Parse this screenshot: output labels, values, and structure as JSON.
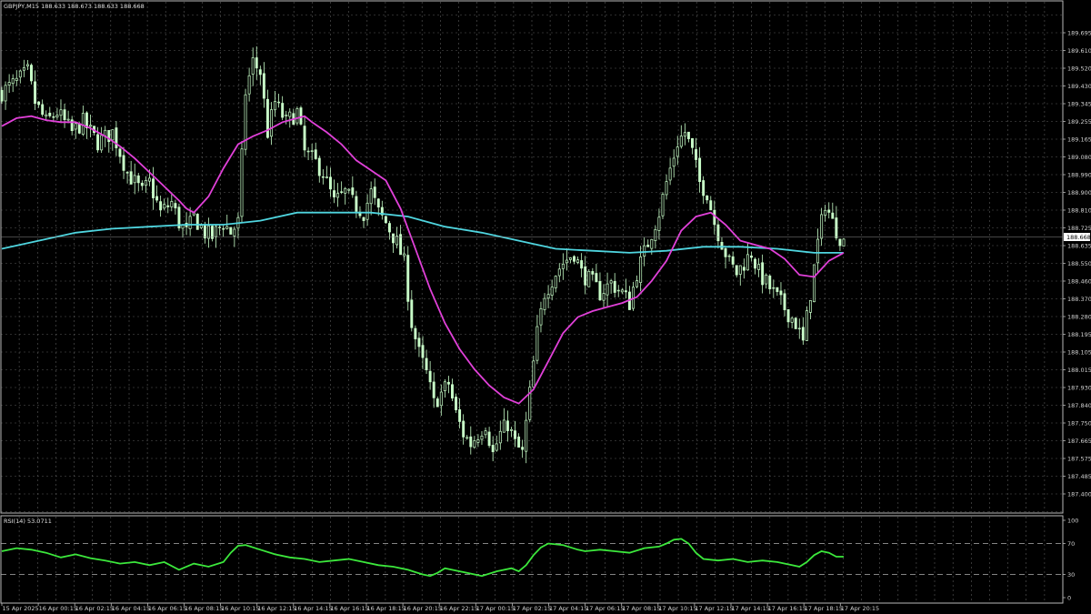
{
  "header": {
    "main_title": "GBPJPY,M15  188.633 188.673 188.633 188.668",
    "rsi_title": "RSI(14) 53.0711"
  },
  "colors": {
    "background": "#000000",
    "grid": "#5a5a5a",
    "candle": "#c9ffc9",
    "ma_fast": "#e040d8",
    "ma_slow": "#4fd5df",
    "rsi": "#3ce83c",
    "axis_text": "#d0d0d0",
    "price_tag_bg": "#ffffff"
  },
  "current_price_label": "188.668",
  "chart_data": [
    {
      "type": "candlestick",
      "title": "GBPJPY,M15",
      "symbol": "GBPJPY",
      "timeframe": "M15",
      "last_bar": {
        "open": 188.633,
        "high": 188.673,
        "low": 188.633,
        "close": 188.668
      },
      "y_ticks": [
        "189.695",
        "189.610",
        "189.520",
        "189.430",
        "189.345",
        "189.255",
        "189.165",
        "189.080",
        "188.990",
        "188.900",
        "188.810",
        "188.725",
        "188.635",
        "188.550",
        "188.460",
        "188.370",
        "188.280",
        "188.195",
        "188.105",
        "188.015",
        "187.930",
        "187.840",
        "187.750",
        "187.665",
        "187.575",
        "187.485",
        "187.400"
      ],
      "ylim": [
        187.4,
        189.695
      ],
      "x_ticks": [
        "15 Apr 2025",
        "16 Apr 00:15",
        "16 Apr 02:15",
        "16 Apr 04:15",
        "16 Apr 06:15",
        "16 Apr 08:15",
        "16 Apr 10:15",
        "16 Apr 12:15",
        "16 Apr 14:15",
        "16 Apr 16:15",
        "16 Apr 18:15",
        "16 Apr 20:15",
        "16 Apr 22:15",
        "17 Apr 00:15",
        "17 Apr 02:15",
        "17 Apr 04:15",
        "17 Apr 06:15",
        "17 Apr 08:15",
        "17 Apr 10:15",
        "17 Apr 12:15",
        "17 Apr 14:15",
        "17 Apr 16:15",
        "17 Apr 18:15",
        "17 Apr 20:15"
      ],
      "price_path": [
        [
          0,
          189.4
        ],
        [
          4,
          189.45
        ],
        [
          7,
          189.5
        ],
        [
          9,
          189.35
        ],
        [
          12,
          189.25
        ],
        [
          15,
          189.3
        ],
        [
          19,
          189.2
        ],
        [
          22,
          189.25
        ],
        [
          26,
          189.15
        ],
        [
          30,
          189.2
        ],
        [
          34,
          189.0
        ],
        [
          38,
          188.9
        ],
        [
          40,
          188.95
        ],
        [
          43,
          188.8
        ],
        [
          46,
          188.85
        ],
        [
          48,
          188.75
        ],
        [
          50,
          188.7
        ],
        [
          52,
          188.78
        ],
        [
          55,
          188.7
        ],
        [
          57,
          188.68
        ],
        [
          60,
          188.75
        ],
        [
          62,
          188.7
        ],
        [
          64,
          188.75
        ],
        [
          66,
          189.4
        ],
        [
          68,
          189.55
        ],
        [
          70,
          189.5
        ],
        [
          72,
          189.2
        ],
        [
          74,
          189.35
        ],
        [
          77,
          189.25
        ],
        [
          80,
          189.3
        ],
        [
          82,
          189.1
        ],
        [
          85,
          189.05
        ],
        [
          87,
          189.0
        ],
        [
          90,
          188.85
        ],
        [
          93,
          188.9
        ],
        [
          95,
          188.85
        ],
        [
          98,
          188.8
        ],
        [
          100,
          188.9
        ],
        [
          102,
          188.8
        ],
        [
          104,
          188.75
        ],
        [
          107,
          188.65
        ],
        [
          109,
          188.55
        ],
        [
          111,
          188.25
        ],
        [
          113,
          188.1
        ],
        [
          115,
          188.0
        ],
        [
          117,
          187.85
        ],
        [
          119,
          187.9
        ],
        [
          121,
          187.95
        ],
        [
          123,
          187.8
        ],
        [
          125,
          187.7
        ],
        [
          127,
          187.65
        ],
        [
          129,
          187.7
        ],
        [
          131,
          187.75
        ],
        [
          133,
          187.6
        ],
        [
          135,
          187.7
        ],
        [
          137,
          187.75
        ],
        [
          139,
          187.65
        ],
        [
          141,
          187.6
        ],
        [
          143,
          187.9
        ],
        [
          145,
          188.2
        ],
        [
          147,
          188.4
        ],
        [
          150,
          188.5
        ],
        [
          152,
          188.55
        ],
        [
          155,
          188.6
        ],
        [
          157,
          188.5
        ],
        [
          160,
          188.45
        ],
        [
          162,
          188.4
        ],
        [
          165,
          188.45
        ],
        [
          168,
          188.4
        ],
        [
          170,
          188.35
        ],
        [
          172,
          188.5
        ],
        [
          174,
          188.6
        ],
        [
          176,
          188.7
        ],
        [
          178,
          188.8
        ],
        [
          180,
          188.95
        ],
        [
          183,
          189.15
        ],
        [
          185,
          189.2
        ],
        [
          187,
          189.1
        ],
        [
          189,
          188.95
        ],
        [
          191,
          188.9
        ],
        [
          193,
          188.75
        ],
        [
          195,
          188.65
        ],
        [
          197,
          188.55
        ],
        [
          199,
          188.5
        ],
        [
          201,
          188.55
        ],
        [
          203,
          188.6
        ],
        [
          205,
          188.5
        ],
        [
          207,
          188.45
        ],
        [
          209,
          188.4
        ],
        [
          211,
          188.35
        ],
        [
          213,
          188.3
        ],
        [
          215,
          188.25
        ],
        [
          217,
          188.15
        ],
        [
          219,
          188.4
        ],
        [
          221,
          188.65
        ],
        [
          223,
          188.85
        ],
        [
          225,
          188.75
        ],
        [
          227,
          188.68
        ]
      ],
      "series": [
        {
          "name": "",
          "points": [
            [
              0,
              189.23
            ],
            [
              4,
              189.27
            ],
            [
              8,
              189.28
            ],
            [
              12,
              189.26
            ],
            [
              16,
              189.25
            ],
            [
              20,
              189.25
            ],
            [
              24,
              189.22
            ],
            [
              28,
              189.18
            ],
            [
              32,
              189.13
            ],
            [
              36,
              189.07
            ],
            [
              40,
              189.0
            ],
            [
              44,
              188.93
            ],
            [
              48,
              188.86
            ],
            [
              50,
              188.82
            ],
            [
              52,
              188.8
            ],
            [
              56,
              188.88
            ],
            [
              60,
              189.02
            ],
            [
              64,
              189.14
            ],
            [
              68,
              189.18
            ],
            [
              72,
              189.21
            ],
            [
              76,
              189.25
            ],
            [
              80,
              189.27
            ],
            [
              82,
              189.28
            ],
            [
              84,
              189.25
            ],
            [
              88,
              189.2
            ],
            [
              92,
              189.14
            ],
            [
              96,
              189.06
            ],
            [
              100,
              189.01
            ],
            [
              104,
              188.96
            ],
            [
              108,
              188.82
            ],
            [
              112,
              188.62
            ],
            [
              116,
              188.42
            ],
            [
              120,
              188.25
            ],
            [
              124,
              188.12
            ],
            [
              128,
              188.02
            ],
            [
              132,
              187.94
            ],
            [
              136,
              187.88
            ],
            [
              140,
              187.85
            ],
            [
              144,
              187.92
            ],
            [
              148,
              188.06
            ],
            [
              152,
              188.2
            ],
            [
              156,
              188.28
            ],
            [
              160,
              188.31
            ],
            [
              164,
              188.33
            ],
            [
              168,
              188.35
            ],
            [
              172,
              188.38
            ],
            [
              176,
              188.46
            ],
            [
              180,
              188.56
            ],
            [
              184,
              188.71
            ],
            [
              188,
              188.78
            ],
            [
              192,
              188.8
            ],
            [
              196,
              188.74
            ],
            [
              200,
              188.66
            ],
            [
              204,
              188.64
            ],
            [
              208,
              188.62
            ],
            [
              212,
              188.57
            ],
            [
              216,
              188.49
            ],
            [
              220,
              188.48
            ],
            [
              224,
              188.56
            ],
            [
              228,
              188.6
            ]
          ]
        },
        {
          "name": "",
          "points": [
            [
              0,
              188.62
            ],
            [
              10,
              188.66
            ],
            [
              20,
              188.7
            ],
            [
              30,
              188.72
            ],
            [
              40,
              188.73
            ],
            [
              50,
              188.74
            ],
            [
              60,
              188.74
            ],
            [
              70,
              188.76
            ],
            [
              80,
              188.8
            ],
            [
              90,
              188.8
            ],
            [
              100,
              188.8
            ],
            [
              110,
              188.78
            ],
            [
              120,
              188.73
            ],
            [
              130,
              188.7
            ],
            [
              140,
              188.66
            ],
            [
              150,
              188.62
            ],
            [
              160,
              188.61
            ],
            [
              170,
              188.6
            ],
            [
              180,
              188.61
            ],
            [
              190,
              188.63
            ],
            [
              200,
              188.63
            ],
            [
              210,
              188.62
            ],
            [
              220,
              188.6
            ],
            [
              228,
              188.6
            ]
          ]
        }
      ]
    },
    {
      "type": "line",
      "title": "RSI(14) 53.0711",
      "ylim": [
        0,
        100
      ],
      "y_ticks": [
        "100",
        "70",
        "30",
        "0"
      ],
      "levels": [
        70,
        30
      ],
      "series": [
        {
          "name": "RSI(14)",
          "points": [
            [
              0,
              60
            ],
            [
              4,
              64
            ],
            [
              8,
              62
            ],
            [
              12,
              58
            ],
            [
              16,
              52
            ],
            [
              20,
              56
            ],
            [
              24,
              51
            ],
            [
              28,
              48
            ],
            [
              32,
              44
            ],
            [
              36,
              46
            ],
            [
              40,
              42
            ],
            [
              44,
              46
            ],
            [
              48,
              36
            ],
            [
              52,
              44
            ],
            [
              56,
              40
            ],
            [
              60,
              46
            ],
            [
              62,
              58
            ],
            [
              64,
              67
            ],
            [
              66,
              68
            ],
            [
              70,
              62
            ],
            [
              74,
              56
            ],
            [
              78,
              52
            ],
            [
              82,
              50
            ],
            [
              86,
              46
            ],
            [
              90,
              48
            ],
            [
              94,
              50
            ],
            [
              98,
              46
            ],
            [
              102,
              42
            ],
            [
              106,
              40
            ],
            [
              110,
              36
            ],
            [
              112,
              33
            ],
            [
              114,
              30
            ],
            [
              116,
              28
            ],
            [
              118,
              32
            ],
            [
              120,
              38
            ],
            [
              124,
              34
            ],
            [
              128,
              30
            ],
            [
              130,
              28
            ],
            [
              134,
              34
            ],
            [
              138,
              38
            ],
            [
              140,
              34
            ],
            [
              142,
              42
            ],
            [
              144,
              55
            ],
            [
              146,
              65
            ],
            [
              148,
              70
            ],
            [
              152,
              68
            ],
            [
              156,
              62
            ],
            [
              158,
              60
            ],
            [
              162,
              62
            ],
            [
              166,
              60
            ],
            [
              170,
              58
            ],
            [
              174,
              64
            ],
            [
              178,
              66
            ],
            [
              180,
              70
            ],
            [
              182,
              75
            ],
            [
              184,
              76
            ],
            [
              186,
              70
            ],
            [
              188,
              58
            ],
            [
              190,
              50
            ],
            [
              194,
              48
            ],
            [
              198,
              50
            ],
            [
              202,
              46
            ],
            [
              206,
              48
            ],
            [
              210,
              46
            ],
            [
              214,
              42
            ],
            [
              216,
              40
            ],
            [
              218,
              46
            ],
            [
              220,
              55
            ],
            [
              222,
              60
            ],
            [
              224,
              58
            ],
            [
              226,
              53
            ],
            [
              228,
              53
            ]
          ]
        }
      ]
    }
  ]
}
